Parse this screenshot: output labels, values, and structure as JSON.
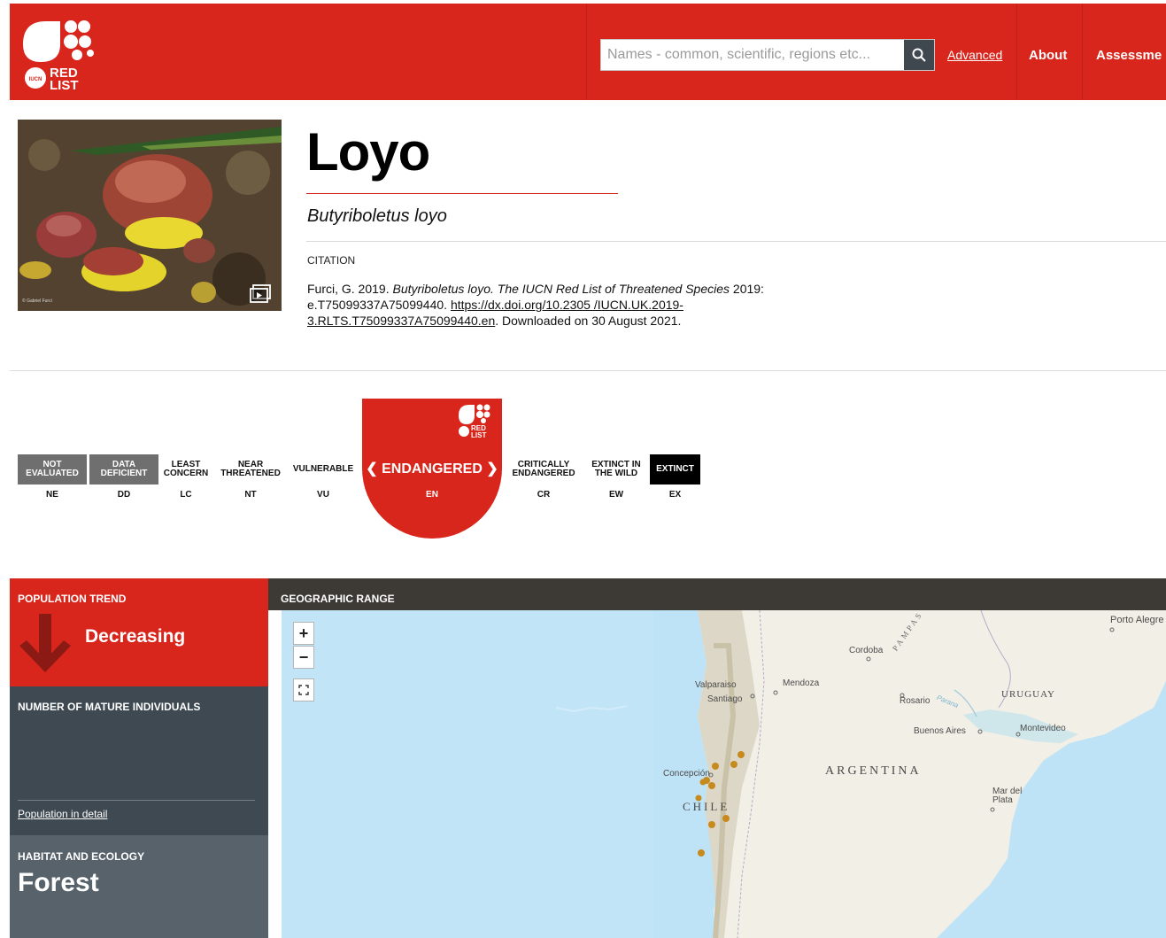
{
  "header": {
    "logo_text": "RED LIST",
    "search": {
      "placeholder": "Names - common, scientific, regions etc...",
      "value": ""
    },
    "advanced_label": "Advanced",
    "nav": [
      "About",
      "Assessme"
    ]
  },
  "species": {
    "common_name": "Loyo",
    "scientific_name": "Butyriboletus loyo",
    "photo_credit": "© Gabriel Furci",
    "citation_label": "CITATION",
    "citation": {
      "authors_year": "Furci, G. 2019. ",
      "species_italic": "Butyriboletus loyo. The IUCN Red List of Threatened Species",
      "mid": " 2019: e.T75099337A75099440. ",
      "doi": "https://dx.doi.org/10.2305 /IUCN.UK.2019-3.RLTS.T75099337A75099440.en",
      "downloaded": ". Downloaded on 30 August 2021."
    }
  },
  "categories": [
    {
      "label": "NOT EVALUATED",
      "code": "NE"
    },
    {
      "label": "DATA DEFICIENT",
      "code": "DD"
    },
    {
      "label": "LEAST CONCERN",
      "code": "LC"
    },
    {
      "label": "NEAR THREATENED",
      "code": "NT"
    },
    {
      "label": "VULNERABLE",
      "code": "VU"
    },
    {
      "label": "ENDANGERED",
      "code": "EN"
    },
    {
      "label": "CRITICALLY ENDANGERED",
      "code": "CR"
    },
    {
      "label": "EXTINCT IN THE WILD",
      "code": "EW"
    },
    {
      "label": "EXTINCT",
      "code": "EX"
    }
  ],
  "selected_category": {
    "label": "ENDANGERED",
    "code": "EN"
  },
  "population": {
    "trend_label": "POPULATION TREND",
    "trend_value": "Decreasing",
    "mature_label": "NUMBER OF MATURE INDIVIDUALS",
    "detail_link": "Population in detail"
  },
  "habitat": {
    "label": "HABITAT AND ECOLOGY",
    "value": "Forest"
  },
  "geographic_range": {
    "label": "GEOGRAPHIC RANGE",
    "controls": {
      "zoom_in": "+",
      "zoom_out": "−",
      "fullscreen": "⛶"
    },
    "places": {
      "porto_alegre": "Porto Alegre",
      "cordoba": "Cordoba",
      "pampas": "PAMPAS",
      "mendoza": "Mendoza",
      "valparaiso": "Valparaiso",
      "santiago": "Santiago",
      "rosario": "Rosario",
      "parana": "Parana",
      "uruguay": "URUGUAY",
      "buenos_aires": "Buenos Aires",
      "montevideo": "Montevideo",
      "concepcion": "Concepción",
      "argentina": "ARGENTINA",
      "chile": "CHILE",
      "mar_del_plata": "Mar del Plata"
    }
  },
  "colors": {
    "brand_red": "#d9261c",
    "dark_slate": "#3e4952",
    "slate": "#57626b",
    "geo_bar": "#3d3935",
    "range_dot": "#c68a1e",
    "ocean": "#bfe3f6",
    "land": "#f2efe7"
  }
}
